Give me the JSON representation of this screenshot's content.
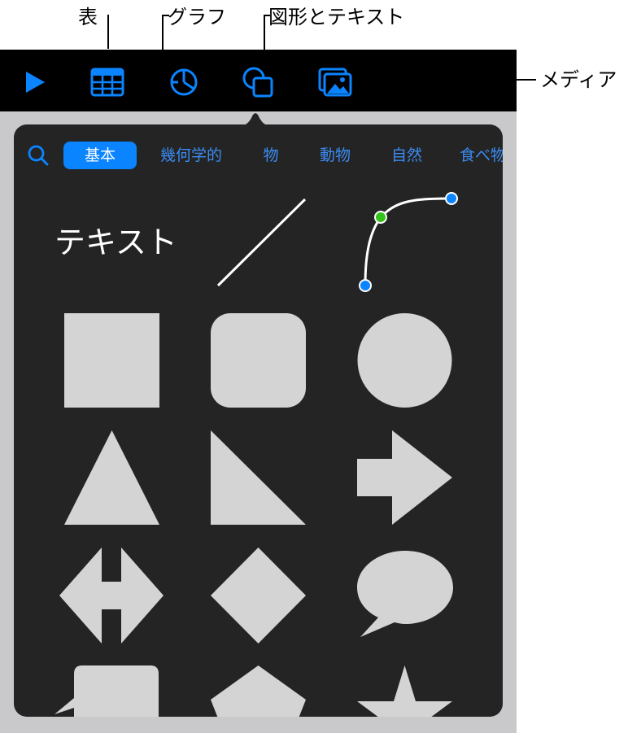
{
  "callouts": {
    "table": "表",
    "chart": "グラフ",
    "shapes_text": "図形とテキスト",
    "media": "メディア"
  },
  "toolbar": {
    "buttons": [
      {
        "icon": "play-icon"
      },
      {
        "icon": "table-icon"
      },
      {
        "icon": "chart-icon"
      },
      {
        "icon": "shapes-icon"
      },
      {
        "icon": "media-icon"
      }
    ]
  },
  "popover": {
    "categories": [
      "基本",
      "幾何学的",
      "物",
      "動物",
      "自然",
      "食べ物"
    ],
    "active_category": "基本",
    "text_shape_label": "テキスト"
  },
  "colors": {
    "accent": "#0a84ff",
    "toolbar_bg": "#000000",
    "popover_bg": "#242424",
    "shape_fill": "#d4d4d4",
    "curve_mid_point": "#34c319"
  }
}
